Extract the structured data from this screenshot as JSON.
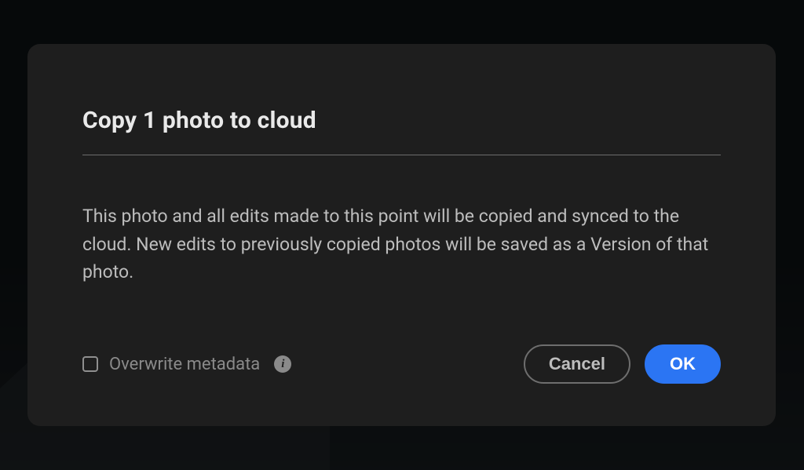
{
  "dialog": {
    "title": "Copy 1 photo to cloud",
    "body": "This photo and all edits made to this point will be copied and synced to the cloud. New edits to previously copied photos will be saved as a Version of that photo.",
    "checkbox_label": "Overwrite metadata",
    "buttons": {
      "cancel": "Cancel",
      "ok": "OK"
    },
    "info_glyph": "i"
  }
}
